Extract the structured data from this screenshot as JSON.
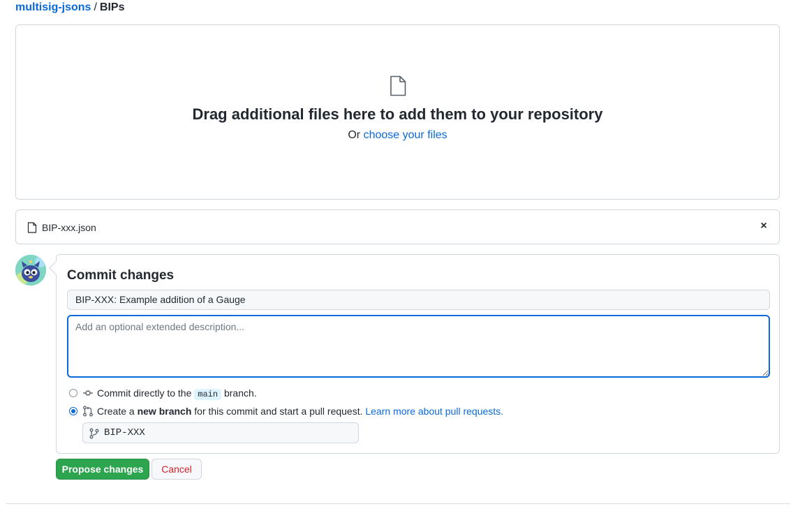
{
  "breadcrumb": {
    "repo": "multisig-jsons",
    "separator": "/",
    "folder": "BIPs"
  },
  "dropzone": {
    "title": "Drag additional files here to add them to your repository",
    "prefix": "Or",
    "link": "choose your files"
  },
  "file": {
    "name": "BIP-xxx.json",
    "remove_label": "×"
  },
  "commit": {
    "heading": "Commit changes",
    "summary_value": "BIP-XXX: Example addition of a Gauge",
    "description_placeholder": "Add an optional extended description...",
    "option_direct": {
      "prefix": "Commit directly to the",
      "branch": "main",
      "suffix": "branch.",
      "selected": false
    },
    "option_new_branch": {
      "prefix": "Create a",
      "bold": "new branch",
      "middle": "for this commit and start a pull request.",
      "link": "Learn more about pull requests.",
      "selected": true
    },
    "branch_name": "BIP-XXX"
  },
  "buttons": {
    "propose": "Propose changes",
    "cancel": "Cancel"
  },
  "colors": {
    "accent": "#0969da",
    "primary_button": "#2da44e",
    "cancel_text": "#cf222e"
  },
  "icons": [
    "file-icon",
    "close-icon",
    "commit-icon",
    "pull-request-icon",
    "branch-icon"
  ]
}
